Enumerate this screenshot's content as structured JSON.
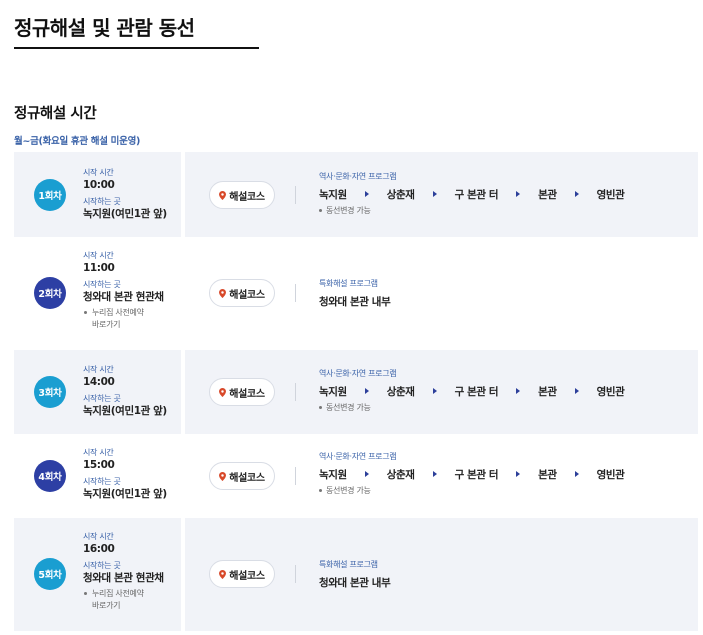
{
  "page_title": "정규해설 및 관람 동선",
  "section_title": "정규해설 시간",
  "notice": "월~금(화요일 휴관 해설 미운영)",
  "labels": {
    "start_time": "시작 시간",
    "start_place": "시작하는 곳",
    "course": "해설코스",
    "reserve_line1": "누리집 사전예약",
    "reserve_line2": "바로가기",
    "route_change": "동선변경 가능"
  },
  "colors": {
    "badge_cyan": "#1a9ed1",
    "badge_navy": "#2d3fa4",
    "label_blue": "#3a62a8",
    "pin_red": "#d8492a"
  },
  "icons": {
    "pin": "map-pin-icon",
    "arrow": "triangle-right-icon"
  },
  "rounds": [
    {
      "badge": "1회차",
      "time": "10:00",
      "place": "녹지원(여민1관 앞)",
      "program": "역사·문화·자연 프로그램",
      "stops": [
        "녹지원",
        "상춘재",
        "구 본관 터",
        "본관",
        "영빈관"
      ]
    },
    {
      "badge": "2회차",
      "time": "11:00",
      "place": "청와대 본관 현관채",
      "program": "특화해설 프로그램",
      "inside": "청와대 본관 내부"
    },
    {
      "badge": "3회차",
      "time": "14:00",
      "place": "녹지원(여민1관 앞)",
      "program": "역사·문화·자연 프로그램",
      "stops": [
        "녹지원",
        "상춘재",
        "구 본관 터",
        "본관",
        "영빈관"
      ]
    },
    {
      "badge": "4회차",
      "time": "15:00",
      "place": "녹지원(여민1관 앞)",
      "program": "역사·문화·자연 프로그램",
      "stops": [
        "녹지원",
        "상춘재",
        "구 본관 터",
        "본관",
        "영빈관"
      ]
    },
    {
      "badge": "5회차",
      "time": "16:00",
      "place": "청와대 본관 현관채",
      "program": "특화해설 프로그램",
      "inside": "청와대 본관 내부"
    }
  ]
}
